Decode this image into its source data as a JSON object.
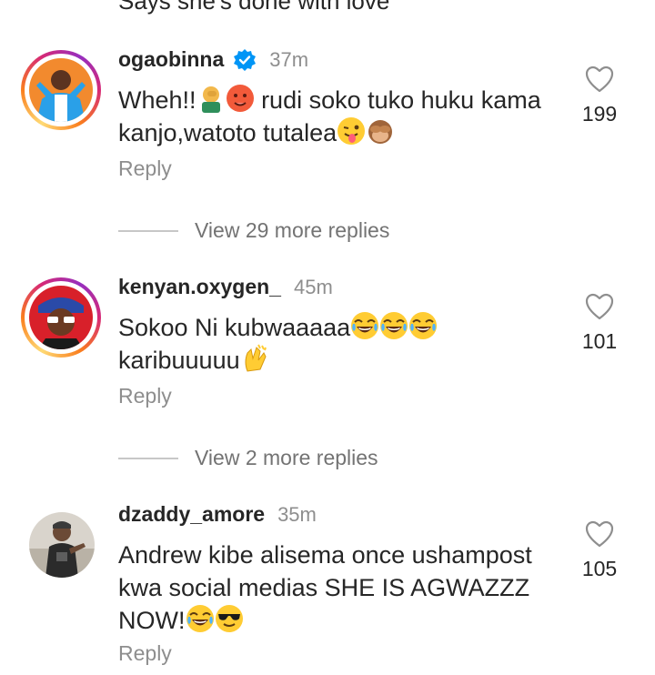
{
  "top_partial_text": "Says she's done with love",
  "comments": [
    {
      "username": "ogaobinna",
      "verified": true,
      "time": "37m",
      "text_line1": "Wheh!!",
      "text_line1b": "rudi soko tuko huku kama",
      "text_line2": "kanjo,watoto tutalea",
      "reply_label": "Reply",
      "likes": "199",
      "view_more": "View 29 more replies"
    },
    {
      "username": "kenyan.oxygen_",
      "verified": false,
      "time": "45m",
      "text_line1": "Sokoo Ni kubwaaaaa",
      "text_line2": "karibuuuuu",
      "reply_label": "Reply",
      "likes": "101",
      "view_more": "View 2 more replies"
    },
    {
      "username": "dzaddy_amore",
      "verified": false,
      "time": "35m",
      "text_line1": "Andrew kibe alisema once ushampost",
      "text_line2": "kwa social medias SHE IS AGWAZZZ",
      "text_line3": "NOW!",
      "reply_label": "Reply",
      "likes": "105"
    }
  ],
  "colors": {
    "secondary_text": "#8e8e8e",
    "verified_blue": "#0095f6",
    "ring_gradient": [
      "#feda75",
      "#fa7e1e",
      "#d62976",
      "#962fbf"
    ]
  }
}
